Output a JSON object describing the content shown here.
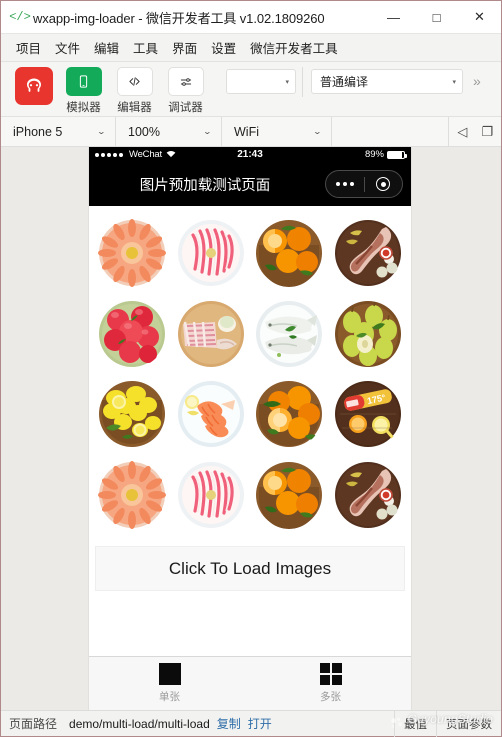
{
  "window": {
    "icon": "code-brackets-icon",
    "title": "wxapp-img-loader - 微信开发者工具 v1.02.1809260",
    "minimize": "—",
    "maximize": "□",
    "close": "✕"
  },
  "menubar": {
    "items": [
      {
        "label": "项目"
      },
      {
        "label": "文件"
      },
      {
        "label": "编辑"
      },
      {
        "label": "工具"
      },
      {
        "label": "界面"
      },
      {
        "label": "设置"
      },
      {
        "label": "微信开发者工具"
      }
    ]
  },
  "toolbar": {
    "logo_icon": "wechat-devtools-logo-icon",
    "buttons": [
      {
        "icon": "simulator-icon",
        "label": "模拟器"
      },
      {
        "icon": "editor-code-icon",
        "label": "编辑器"
      },
      {
        "icon": "debugger-sliders-icon",
        "label": "调试器"
      }
    ],
    "env_select": {
      "value": "",
      "caret": "▾"
    },
    "compile_select": {
      "value": "普通编译",
      "caret": "▾"
    },
    "more_icon": "double-chevron-right-icon",
    "more_label": "»"
  },
  "devicebar": {
    "device": {
      "value": "iPhone 5",
      "caret": "⌄"
    },
    "zoom": {
      "value": "100%",
      "caret": "⌄"
    },
    "network": {
      "value": "WiFi",
      "caret": "⌄"
    },
    "mute_icon": "speaker-mute-icon",
    "mute_glyph": "◁",
    "detach_icon": "detach-window-icon",
    "detach_glyph": "❐"
  },
  "simulator": {
    "statusbar": {
      "carrier": "WeChat",
      "wifi_glyph": "▮",
      "time": "21:43",
      "battery_text": "89%",
      "battery_level": 89
    },
    "navbar": {
      "title": "图片预加载测试页面",
      "capsule_menu_icon": "ellipsis-icon",
      "capsule_target_icon": "target-circle-icon"
    },
    "page": {
      "images": [
        {
          "name": "shrimp-platter",
          "alt": "虾拼盘"
        },
        {
          "name": "sliced-pork",
          "alt": "肥牛卷"
        },
        {
          "name": "orange-basket",
          "alt": "橙子篮"
        },
        {
          "name": "lamb-leg-board",
          "alt": "羊腿砧板"
        },
        {
          "name": "red-apples",
          "alt": "红苹果"
        },
        {
          "name": "raw-fish-board",
          "alt": "生鱼砧板"
        },
        {
          "name": "whole-fish-plate",
          "alt": "鱼盘"
        },
        {
          "name": "pear-basket",
          "alt": "梨篮"
        },
        {
          "name": "lemon-basket",
          "alt": "柠檬篮"
        },
        {
          "name": "cooked-shrimp-plate",
          "alt": "熟虾盘"
        },
        {
          "name": "orange-basket-2",
          "alt": "橙子篮二"
        },
        {
          "name": "juice-bottle-board",
          "alt": "果汁瓶"
        },
        {
          "name": "shrimp-platter-2",
          "alt": "虾拼盘二"
        },
        {
          "name": "sliced-pork-2",
          "alt": "肥牛卷二"
        },
        {
          "name": "orange-basket-3",
          "alt": "橙子篮三"
        },
        {
          "name": "lamb-leg-board-2",
          "alt": "羊腿砧板二"
        }
      ],
      "load_button_label": "Click To Load Images"
    },
    "tabbar": {
      "tabs": [
        {
          "icon": "single-square-icon",
          "label": "单张"
        },
        {
          "icon": "multi-grid-icon",
          "label": "多张"
        }
      ]
    }
  },
  "statusfoot": {
    "label": "页面路径",
    "path": "demo/multi-load/multi-load",
    "copy_link": "复制",
    "open_link": "打开",
    "right_cells": [
      {
        "label": "最值"
      },
      {
        "label": "页面参数"
      }
    ],
    "watermark": "GuyoungStudio",
    "watermark_logo_icon": "studio-mark-icon"
  },
  "colors": {
    "accent_red": "#e8352e",
    "accent_green": "#13ab5a",
    "title_icon_green": "#3aa757",
    "link_blue": "#2e6ea8",
    "phone_black": "#000000",
    "tab_inactive": "#999999"
  }
}
